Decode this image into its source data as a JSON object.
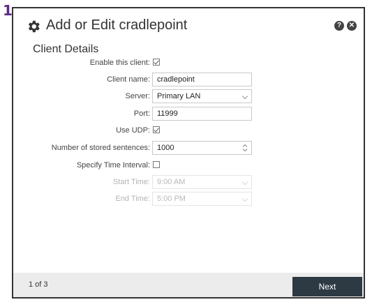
{
  "step_badge": "1",
  "dialog": {
    "title": "Add or Edit cradlepoint",
    "help_icon": "?",
    "close_icon": "✕",
    "section_title": "Client Details"
  },
  "form": {
    "enable_client": {
      "label": "Enable this client:",
      "checked": true
    },
    "client_name": {
      "label": "Client name:",
      "value": "cradlepoint"
    },
    "server": {
      "label": "Server:",
      "value": "Primary LAN"
    },
    "port": {
      "label": "Port:",
      "value": "11999"
    },
    "use_udp": {
      "label": "Use UDP:",
      "checked": true
    },
    "stored_sentences": {
      "label": "Number of stored sentences:",
      "value": "1000"
    },
    "specify_time_interval": {
      "label": "Specify Time Interval:",
      "checked": false
    },
    "start_time": {
      "label": "Start Time:",
      "value": "9:00 AM"
    },
    "end_time": {
      "label": "End Time:",
      "value": "5:00 PM"
    }
  },
  "footer": {
    "page_indicator": "1 of 3",
    "next_label": "Next"
  },
  "colors": {
    "badge": "#5b2a86",
    "next_button": "#2d3a44",
    "footer_bg": "#ececec"
  }
}
